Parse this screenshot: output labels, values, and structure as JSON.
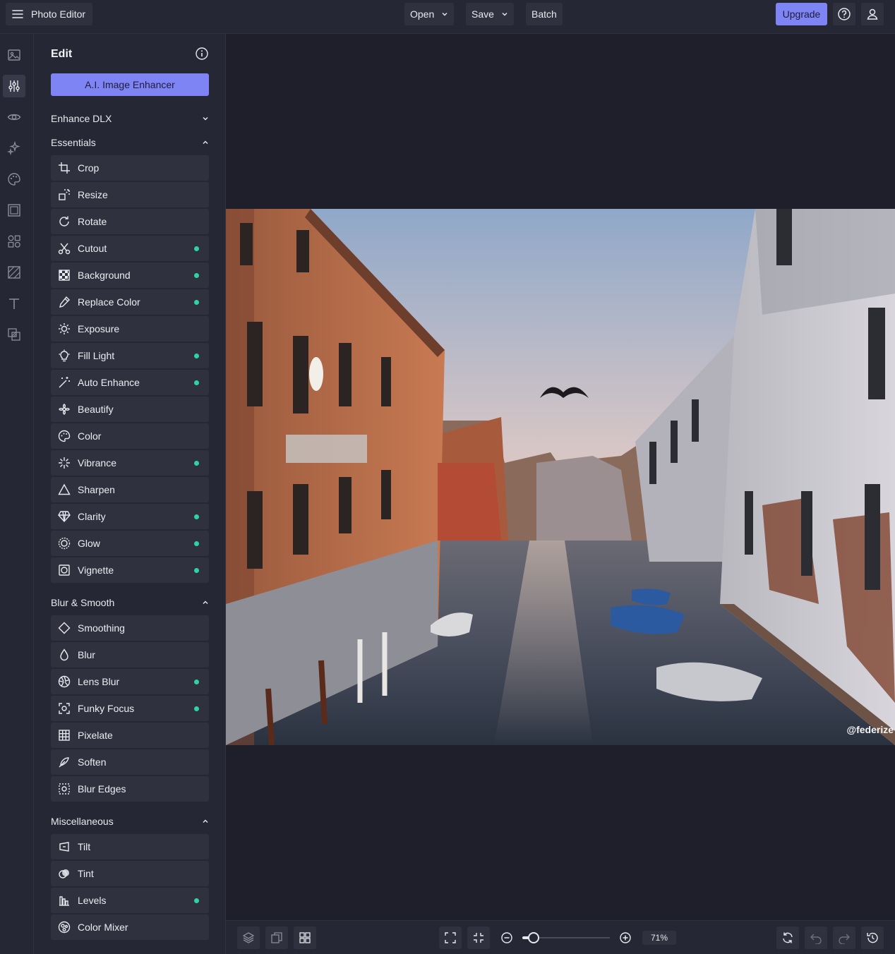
{
  "app": {
    "title": "Photo Editor"
  },
  "toolbar": {
    "open_label": "Open",
    "save_label": "Save",
    "batch_label": "Batch",
    "upgrade_label": "Upgrade"
  },
  "rail": {
    "items": [
      "image-icon",
      "sliders-icon",
      "eye-icon",
      "sparkle-icon",
      "palette-icon",
      "frame-icon",
      "shapes-icon",
      "texture-icon",
      "text-icon",
      "layers-icon"
    ],
    "active": "sliders-icon"
  },
  "panel": {
    "title": "Edit",
    "ai_button": "A.I. Image Enhancer",
    "sections": {
      "enhance": {
        "label": "Enhance DLX",
        "expanded": false
      },
      "essentials": {
        "label": "Essentials",
        "expanded": true,
        "items": [
          {
            "label": "Crop",
            "icon": "crop-icon",
            "dot": false
          },
          {
            "label": "Resize",
            "icon": "resize-icon",
            "dot": false
          },
          {
            "label": "Rotate",
            "icon": "rotate-icon",
            "dot": false
          },
          {
            "label": "Cutout",
            "icon": "scissors-icon",
            "dot": true
          },
          {
            "label": "Background",
            "icon": "checkerboard-icon",
            "dot": true
          },
          {
            "label": "Replace Color",
            "icon": "eyedropper-icon",
            "dot": true
          },
          {
            "label": "Exposure",
            "icon": "exposure-icon",
            "dot": false
          },
          {
            "label": "Fill Light",
            "icon": "bulb-icon",
            "dot": true
          },
          {
            "label": "Auto Enhance",
            "icon": "magic-wand-icon",
            "dot": true
          },
          {
            "label": "Beautify",
            "icon": "flower-icon",
            "dot": false
          },
          {
            "label": "Color",
            "icon": "palette-icon",
            "dot": false
          },
          {
            "label": "Vibrance",
            "icon": "sparkle-icon",
            "dot": true
          },
          {
            "label": "Sharpen",
            "icon": "triangle-icon",
            "dot": false
          },
          {
            "label": "Clarity",
            "icon": "diamond-icon",
            "dot": true
          },
          {
            "label": "Glow",
            "icon": "glow-icon",
            "dot": true
          },
          {
            "label": "Vignette",
            "icon": "vignette-icon",
            "dot": true
          }
        ]
      },
      "blur": {
        "label": "Blur & Smooth",
        "expanded": true,
        "items": [
          {
            "label": "Smoothing",
            "icon": "smooth-diamond-icon",
            "dot": false
          },
          {
            "label": "Blur",
            "icon": "drop-icon",
            "dot": false
          },
          {
            "label": "Lens Blur",
            "icon": "aperture-icon",
            "dot": true
          },
          {
            "label": "Funky Focus",
            "icon": "focus-icon",
            "dot": true
          },
          {
            "label": "Pixelate",
            "icon": "grid-icon",
            "dot": false
          },
          {
            "label": "Soften",
            "icon": "feather-icon",
            "dot": false
          },
          {
            "label": "Blur Edges",
            "icon": "blur-edges-icon",
            "dot": false
          }
        ]
      },
      "misc": {
        "label": "Miscellaneous",
        "expanded": true,
        "items": [
          {
            "label": "Tilt",
            "icon": "tilt-icon",
            "dot": false
          },
          {
            "label": "Tint",
            "icon": "tint-icon",
            "dot": false
          },
          {
            "label": "Levels",
            "icon": "levels-icon",
            "dot": true
          },
          {
            "label": "Color Mixer",
            "icon": "mixer-icon",
            "dot": false
          }
        ]
      }
    }
  },
  "canvas": {
    "image_subject": "Venice canal at sunset",
    "watermark": "@federize"
  },
  "bottom": {
    "zoom_value": "71%",
    "zoom_level": 0.71
  },
  "colors": {
    "accent": "#7f84f5",
    "dot": "#2ed3a4",
    "bg": "#1e1f2b",
    "panel": "#262734",
    "button": "#30313e"
  }
}
